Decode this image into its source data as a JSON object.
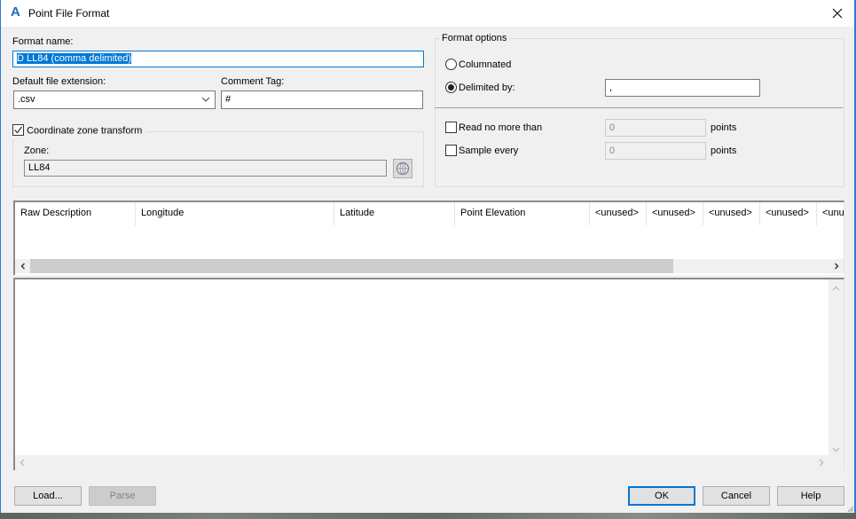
{
  "window": {
    "title": "Point File Format",
    "app_icon": "autocad-civil-icon",
    "close_icon": "close-icon"
  },
  "format_name": {
    "label": "Format name:",
    "value": "D LL84 (comma delimited)"
  },
  "file_extension": {
    "label": "Default file extension:",
    "value": ".csv"
  },
  "comment_tag": {
    "label": "Comment Tag:",
    "value": "#"
  },
  "coordinate_zone": {
    "checkbox_label": "Coordinate zone transform",
    "checked": true,
    "zone_label": "Zone:",
    "zone_value": "LL84",
    "zone_button_icon": "globe-icon"
  },
  "format_options": {
    "caption": "Format options",
    "columnated_label": "Columnated",
    "columnated_selected": false,
    "delimited_label": "Delimited by:",
    "delimited_selected": true,
    "delimiter_value": ",",
    "read_limit_label": "Read no more than",
    "read_limit_checked": false,
    "read_limit_value": "0",
    "read_limit_unit": "points",
    "sample_label": "Sample every",
    "sample_checked": false,
    "sample_value": "0",
    "sample_unit": "points"
  },
  "columns": [
    "Raw Description",
    "Longitude",
    "Latitude",
    "Point Elevation",
    "<unused>",
    "<unused>",
    "<unused>",
    "<unused>",
    "<unused>"
  ],
  "buttons": {
    "load": "Load...",
    "parse": "Parse",
    "ok": "OK",
    "cancel": "Cancel",
    "help": "Help"
  }
}
